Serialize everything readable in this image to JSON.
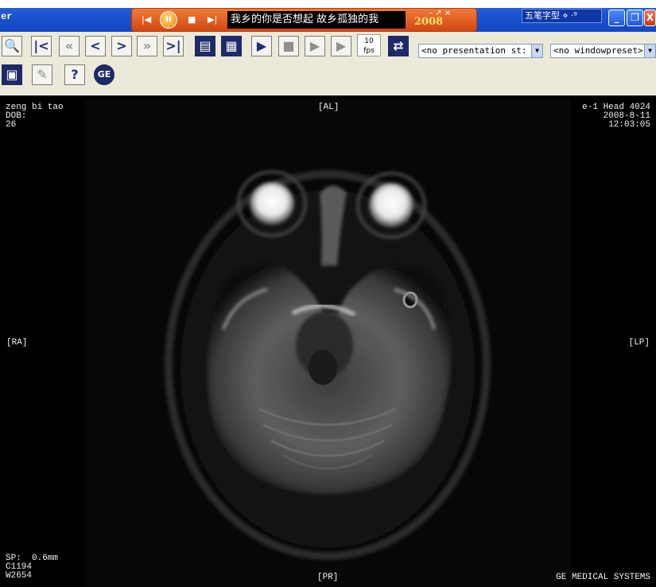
{
  "window": {
    "title": "er",
    "controls": {
      "minimize": "_",
      "restore": "❐",
      "close": "X"
    }
  },
  "media_player": {
    "prev": "|◀",
    "pause": "II",
    "stop": "■",
    "next": "▶|",
    "song": "我乡的你是否想起   故乡孤独的我",
    "year_badge": "2008",
    "mini_controls": "– ↗ ×"
  },
  "ime_bar": {
    "label": "五笔字型",
    "extra": "⋄ ·⁹"
  },
  "toolbar": {
    "fps_value": "10",
    "fps_unit": "fps",
    "presentation_select": "<no presentation st:",
    "window_preset_select": "<no windowpreset>",
    "buttons": {
      "zoom": "🔍",
      "first": "|<",
      "fast_back": "«",
      "prev": "<",
      "next": ">",
      "fast_forward": "»",
      "last": ">|",
      "layout1": "▤",
      "layout2": "▦",
      "play": "▶",
      "stop": "■",
      "slower": "▶",
      "faster": "▶",
      "export": "⇄",
      "invert": "▣",
      "annotate": "✎",
      "help": "?",
      "ge_logo": "GE"
    }
  },
  "viewer": {
    "top_left": "zeng bi tao\nDOB:\n26",
    "top_center": "[AL]",
    "top_right": "e-1 Head 4024\n2008-8-11\n12:03:05",
    "left_mid": "[RA]",
    "right_mid": "[LP]",
    "bottom_left": "SP:  0.6mm\nC1194\nW2654",
    "bottom_center": "[PR]",
    "bottom_right": "GE MEDICAL SYSTEMS"
  }
}
